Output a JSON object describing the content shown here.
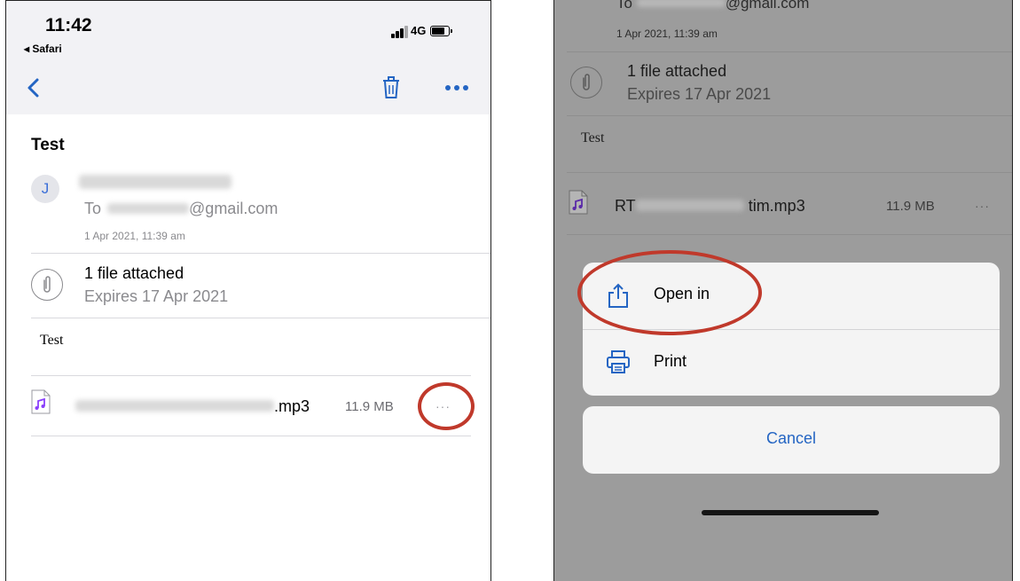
{
  "left_screen": {
    "status_bar": {
      "time": "11:42",
      "back_app": "Safari",
      "network": "4G"
    },
    "nav": {
      "back_icon": "chevron-left-icon",
      "trash_icon": "trash-icon",
      "more_icon": "ellipsis-icon"
    },
    "email": {
      "subject": "Test",
      "sender_initial": "J",
      "to_prefix": "To",
      "to_domain": "@gmail.com",
      "date": "1 Apr 2021, 11:39 am"
    },
    "attachment_banner": {
      "title": "1 file attached",
      "expiry": "Expires 17 Apr 2021"
    },
    "body": "Test",
    "file": {
      "name_suffix": ".mp3",
      "size": "11.9 MB",
      "more": "···"
    }
  },
  "right_screen": {
    "email": {
      "to_prefix": "To",
      "to_domain": "@gmail.com",
      "date": "1 Apr 2021, 11:39 am"
    },
    "attachment_banner": {
      "title": "1 file attached",
      "expiry": "Expires 17 Apr 2021"
    },
    "body": "Test",
    "file": {
      "name_prefix": "RT",
      "name_suffix": "tim.mp3",
      "size": "11.9 MB",
      "more": "···"
    },
    "action_sheet": {
      "items": [
        {
          "label": "Open in",
          "icon": "share-icon"
        },
        {
          "label": "Print",
          "icon": "printer-icon"
        }
      ],
      "cancel": "Cancel"
    }
  },
  "colors": {
    "accent": "#2465c3",
    "highlight_ring": "#c0392b",
    "dim_overlay": "#9c9c9c",
    "file_icon": "#8a3ffc"
  }
}
